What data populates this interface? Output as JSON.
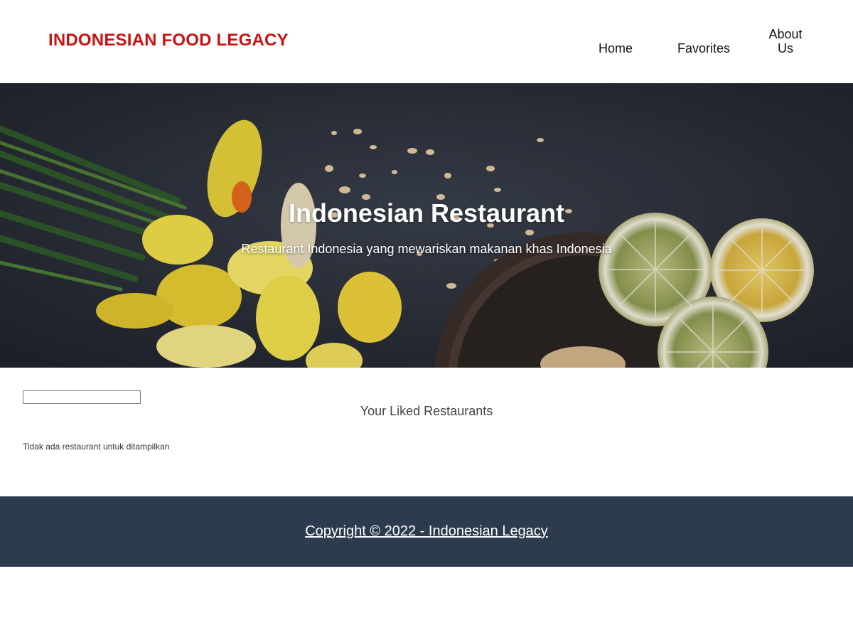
{
  "header": {
    "brand": "INDONESIAN FOOD LEGACY",
    "nav": {
      "home": "Home",
      "favorites": "Favorites",
      "about": "About Us"
    }
  },
  "hero": {
    "title": "Indonesian Restaurant",
    "subtitle": "Restaurant Indonesia yang mewariskan makanan khas Indonesia"
  },
  "main": {
    "search_value": "",
    "section_title": "Your Liked Restaurants",
    "empty_message": "Tidak ada restaurant untuk ditampilkan"
  },
  "footer": {
    "copyright": "Copyright © 2022 - Indonesian Legacy"
  },
  "colors": {
    "brand": "#cc1111",
    "footer_bg": "#2c3b4e",
    "hero_bg": "#2b2f38"
  }
}
